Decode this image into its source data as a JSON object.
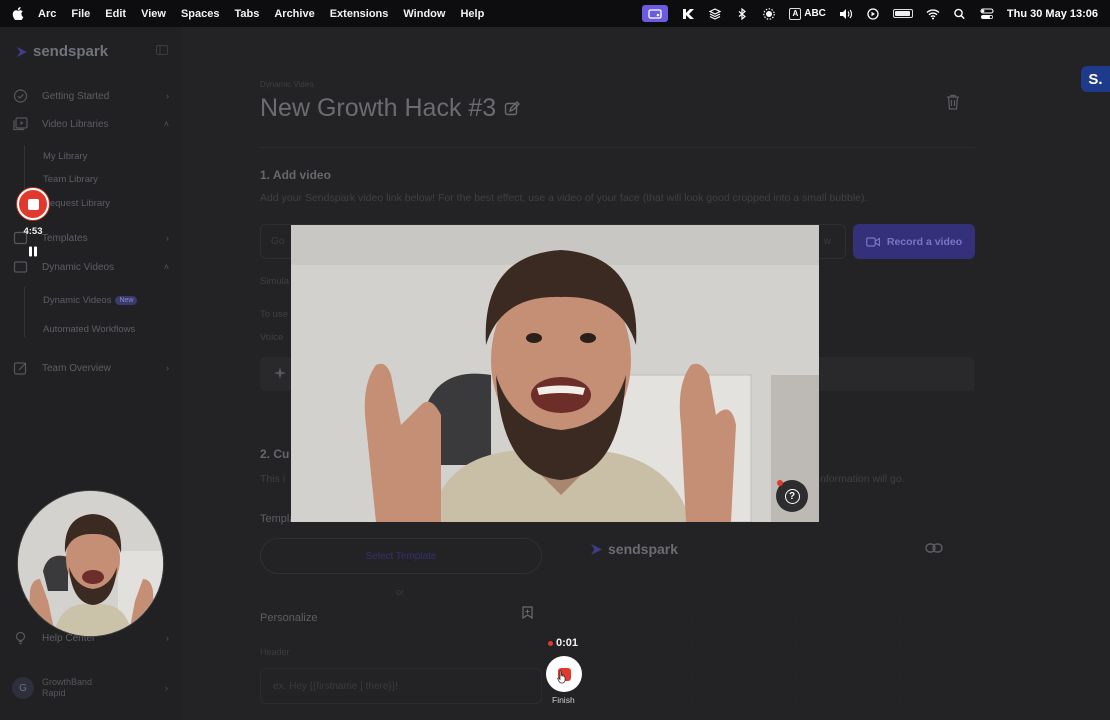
{
  "menubar": {
    "app": "Arc",
    "menus": [
      "File",
      "Edit",
      "View",
      "Spaces",
      "Tabs",
      "Archive",
      "Extensions",
      "Window",
      "Help"
    ],
    "input_source": "ABC",
    "clock": "Thu 30 May  13:06"
  },
  "sidebar": {
    "brand": "sendspark",
    "items": [
      {
        "label": "Getting Started",
        "icon": "check-circle-icon"
      },
      {
        "label": "Video Libraries",
        "icon": "video-library-icon"
      },
      {
        "label": "My Library"
      },
      {
        "label": "Team Library"
      },
      {
        "label": "Request Library"
      },
      {
        "label": "Templates",
        "icon": "templates-icon"
      },
      {
        "label": "Dynamic Videos",
        "icon": "dynamic-videos-icon"
      },
      {
        "label": "Dynamic Videos",
        "badge": "New"
      },
      {
        "label": "Automated Workflows"
      },
      {
        "label": "Team Overview",
        "icon": "team-overview-icon"
      },
      {
        "label": "Help Center",
        "icon": "lightbulb-icon"
      }
    ],
    "account": {
      "initial": "G",
      "name": "GrowthBand",
      "plan": "Rapid"
    }
  },
  "main": {
    "breadcrumb": "Dynamic Video",
    "title": "New Growth Hack #3",
    "section1": {
      "title": "1. Add video",
      "description": "Add your Sendspark video link below! For the best effect, use a video of your face (that will look good cropped into a small bubble).",
      "input_placeholder": "Go",
      "input_suffix": "w",
      "record_button": "Record a video",
      "simulate_label": "Simula",
      "to_use_label": "To use",
      "voice_label": "Voice"
    },
    "section2": {
      "title": "2. Cu",
      "description_start": "This i",
      "description_end": "nformation will go."
    },
    "template_label": "Templa",
    "select_template": "Select Template",
    "or": "or",
    "personalize": "Personalize",
    "header_label": "Header",
    "header_placeholder": "ex. Hey {{firstname | there}}!",
    "preview_brand": "sendspark"
  },
  "recorder": {
    "elapsed": "4:53",
    "finish_timer": "0:01",
    "finish_label": "Finish"
  },
  "extension_badge": "S.",
  "colors": {
    "record_red": "#e2392f",
    "brand_purple": "#34307a",
    "extension_blue": "#1e3a8a"
  }
}
